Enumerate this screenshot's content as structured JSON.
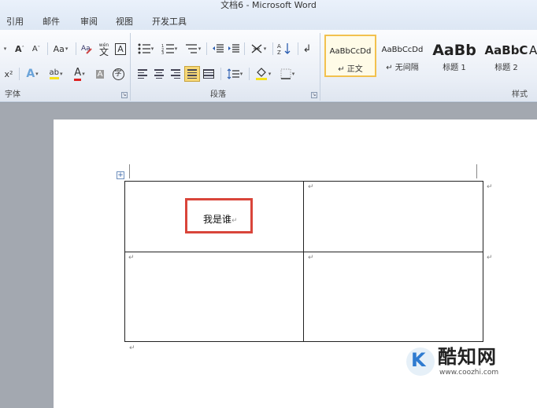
{
  "window": {
    "title": "文档6 - Microsoft Word"
  },
  "menu": {
    "tabs": [
      "引用",
      "邮件",
      "审阅",
      "视图",
      "开发工具"
    ]
  },
  "ribbon": {
    "font": {
      "label": "字体",
      "grow_font": "A",
      "shrink_font": "A",
      "change_case": "Aa",
      "phonetic": "wén",
      "char_border": "A",
      "superscript": "x²",
      "text_effects": "A",
      "highlight": "ab",
      "font_color": "A",
      "char_shading": "A",
      "enclose": "字"
    },
    "paragraph": {
      "label": "段落"
    },
    "styles": {
      "label": "样式",
      "items": [
        {
          "sample": "AaBbCcDd",
          "name": "↵ 正文"
        },
        {
          "sample": "AaBbCcDd",
          "name": "↵ 无间隔"
        },
        {
          "sample": "AaBb",
          "name": "标题 1"
        },
        {
          "sample": "AaBbC",
          "name": "标题 2"
        },
        {
          "sample": "A",
          "name": ""
        }
      ]
    }
  },
  "document": {
    "table": {
      "cells": [
        {
          "text": "我是谁",
          "mark": "↵"
        },
        {
          "text": "",
          "mark": "↵"
        },
        {
          "text": "",
          "mark": "↵"
        },
        {
          "text": "",
          "mark": "↵"
        }
      ],
      "row_end_mark": "↵",
      "after_table_mark": "↵"
    }
  },
  "watermark": {
    "title": "酷知网",
    "url": "www.coozhi.com"
  },
  "colors": {
    "highlight_box": "#d9453a",
    "selected_style": "#f2c14e"
  }
}
